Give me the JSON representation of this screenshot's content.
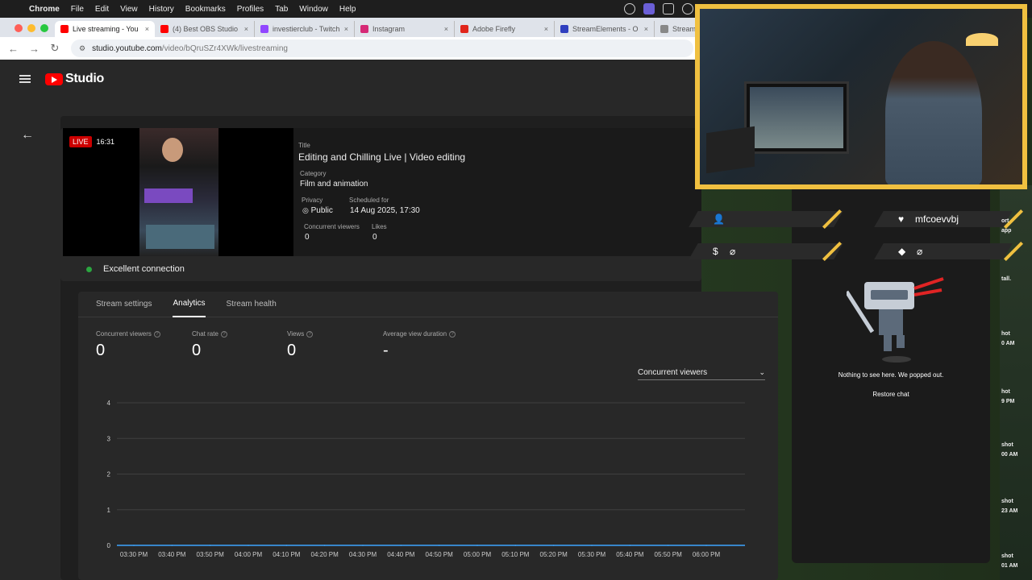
{
  "menubar": {
    "app": "Chrome",
    "items": [
      "File",
      "Edit",
      "View",
      "History",
      "Bookmarks",
      "Profiles",
      "Tab",
      "Window",
      "Help"
    ]
  },
  "browser": {
    "tabs": [
      {
        "title": "Live streaming - You",
        "icon": "youtube-icon",
        "color": "#ff0000",
        "active": true
      },
      {
        "title": "(4) Best OBS Studio",
        "icon": "youtube-icon",
        "color": "#ff0000",
        "active": false
      },
      {
        "title": "investierclub - Twitch",
        "icon": "twitch-icon",
        "color": "#9146ff",
        "active": false
      },
      {
        "title": "Instagram",
        "icon": "instagram-icon",
        "color": "#d62976",
        "active": false
      },
      {
        "title": "Adobe Firefly",
        "icon": "adobe-icon",
        "color": "#e1251b",
        "active": false
      },
      {
        "title": "StreamElements - O",
        "icon": "streamelements-icon",
        "color": "#2f3fbf",
        "active": false
      },
      {
        "title": "Stream",
        "icon": "stream-icon",
        "color": "#888888",
        "active": false
      }
    ],
    "url_host": "studio.youtube.com",
    "url_path": "/video/bQruSZr4XWk/livestreaming"
  },
  "studio": {
    "logo": "Studio",
    "live_badge": "LIVE",
    "live_time": "16:31",
    "title_label": "Title",
    "title": "Editing and Chilling Live | Video editing",
    "category_label": "Category",
    "category": "Film and animation",
    "privacy_label": "Privacy",
    "privacy": "Public",
    "scheduled_label": "Scheduled for",
    "scheduled": "14 Aug 2025, 17:30",
    "concurrent_label": "Concurrent viewers",
    "concurrent": "0",
    "likes_label": "Likes",
    "likes": "0",
    "connection": "Excellent connection",
    "tabs": [
      "Stream settings",
      "Analytics",
      "Stream health"
    ],
    "stats": [
      {
        "label": "Concurrent viewers",
        "value": "0"
      },
      {
        "label": "Chat rate",
        "value": "0"
      },
      {
        "label": "Views",
        "value": "0"
      },
      {
        "label": "Average view duration",
        "value": "-"
      }
    ],
    "metric_select": "Concurrent viewers"
  },
  "chart_data": {
    "type": "line",
    "x": [
      "03:30 PM",
      "03:40 PM",
      "03:50 PM",
      "04:00 PM",
      "04:10 PM",
      "04:20 PM",
      "04:30 PM",
      "04:40 PM",
      "04:50 PM",
      "05:00 PM",
      "05:10 PM",
      "05:20 PM",
      "05:30 PM",
      "05:40 PM",
      "05:50 PM",
      "06:00 PM"
    ],
    "series": [
      {
        "values": [
          0,
          0,
          0,
          0,
          0,
          0,
          0,
          0,
          0,
          0,
          0,
          0,
          0,
          0,
          0,
          0
        ]
      }
    ],
    "yticks": [
      0,
      1,
      2,
      3,
      4
    ],
    "ylim": [
      0,
      4
    ],
    "grid": true,
    "line_color": "#3ea6ff"
  },
  "overlay": {
    "alerts": [
      {
        "icon": "follower-icon",
        "value": ""
      },
      {
        "icon": "heart-icon",
        "value": "mfcoevvbj"
      },
      {
        "icon": "dollar-icon",
        "value": "⌀"
      },
      {
        "icon": "diamond-icon",
        "value": "⌀"
      }
    ],
    "chat_empty": "Nothing to see here. We popped out.",
    "restore_chat": "Restore chat",
    "accent": "#f0c040"
  },
  "edge_texts": [
    "ort",
    "app",
    "tall.",
    "hot",
    "0 AM",
    "hot",
    "9 PM",
    "shot",
    "00 AM",
    "shot",
    "23 AM",
    "shot",
    "01 AM"
  ]
}
